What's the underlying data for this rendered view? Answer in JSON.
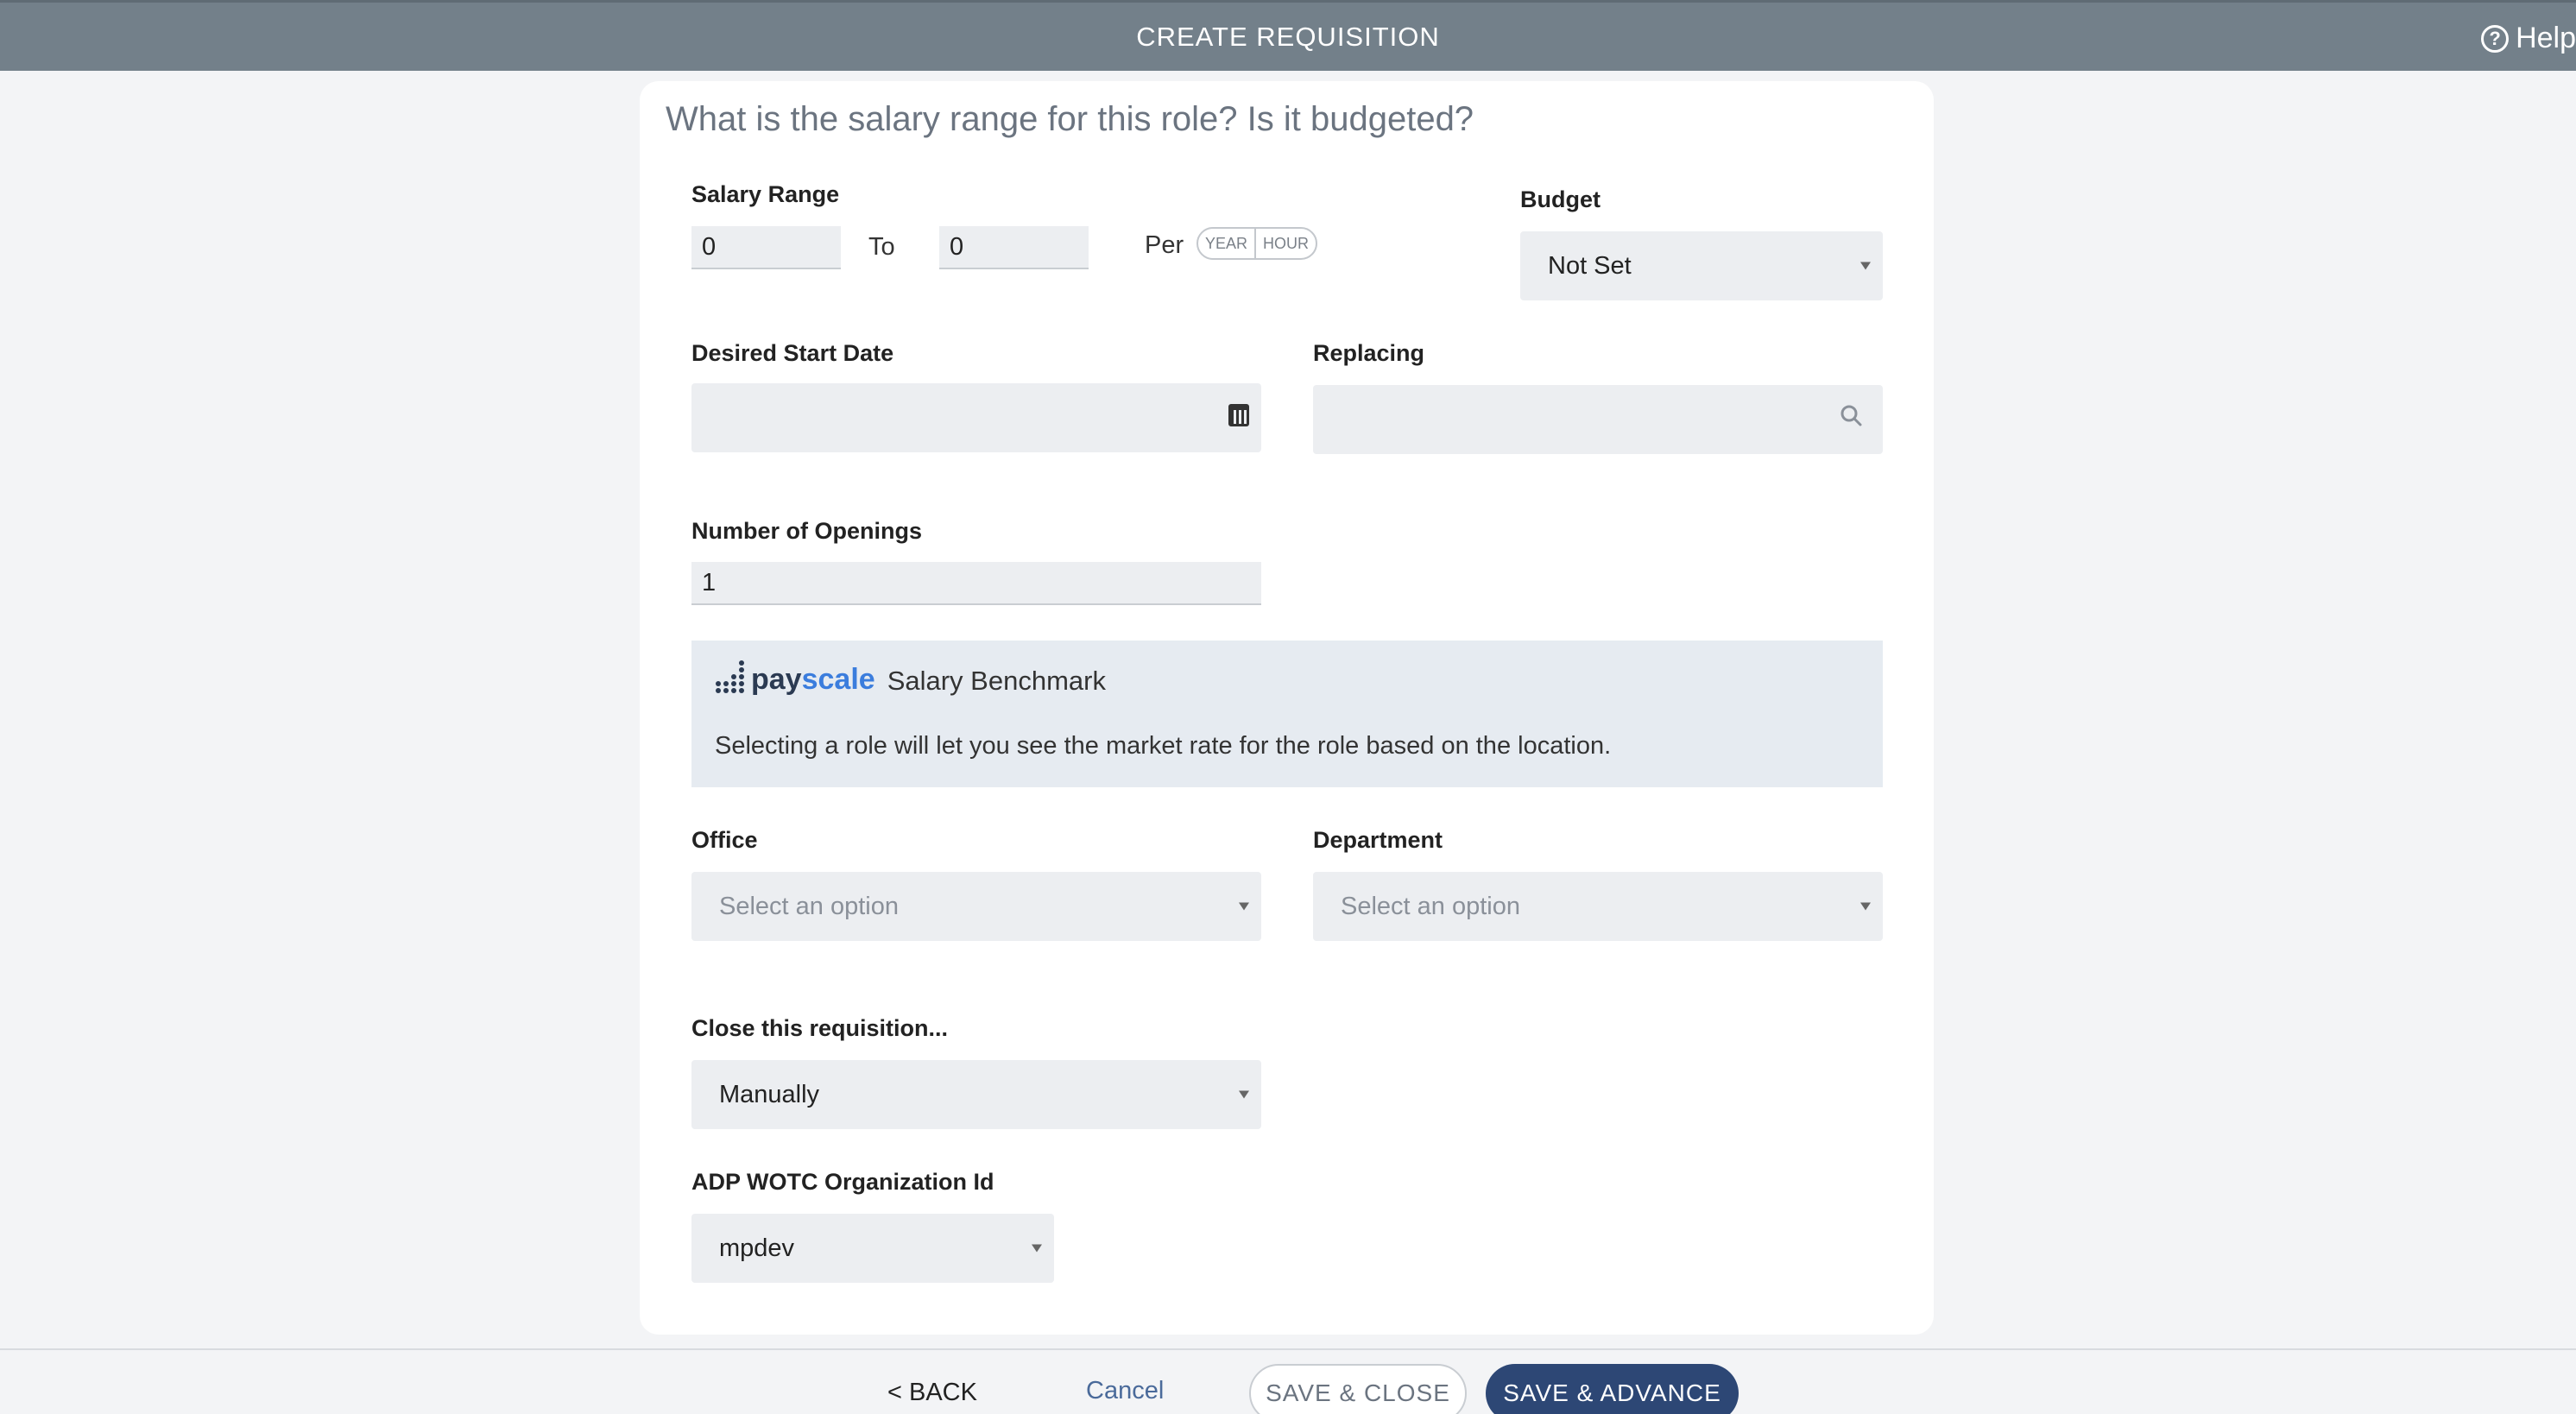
{
  "header": {
    "title": "CREATE REQUISITION",
    "help_label": "Help"
  },
  "question": "What is the salary range for this role? Is it budgeted?",
  "salary": {
    "label": "Salary Range",
    "min_value": "0",
    "to_label": "To",
    "max_value": "0",
    "per_label": "Per",
    "unit_year": "YEAR",
    "unit_hour": "HOUR"
  },
  "budget": {
    "label": "Budget",
    "value": "Not Set"
  },
  "start_date": {
    "label": "Desired Start Date",
    "value": ""
  },
  "replacing": {
    "label": "Replacing",
    "value": ""
  },
  "openings": {
    "label": "Number of Openings",
    "value": "1"
  },
  "payscale": {
    "logo_pay": "pay",
    "logo_scale": "scale",
    "title": "Salary Benchmark",
    "message": "Selecting a role will let you see the market rate for the role based on the location."
  },
  "office": {
    "label": "Office",
    "placeholder": "Select an option"
  },
  "department": {
    "label": "Department",
    "placeholder": "Select an option"
  },
  "close_requisition": {
    "label": "Close this requisition...",
    "value": "Manually"
  },
  "adp": {
    "label": "ADP WOTC Organization Id",
    "value": "mpdev"
  },
  "footer": {
    "back_label": "< BACK",
    "cancel_label": "Cancel",
    "save_close_label": "SAVE & CLOSE",
    "save_advance_label": "SAVE & ADVANCE"
  },
  "colors": {
    "header_bg": "#73808a",
    "primary_button": "#2d4775",
    "link": "#4a6a9a",
    "payscale_blue": "#3b7ddd"
  }
}
